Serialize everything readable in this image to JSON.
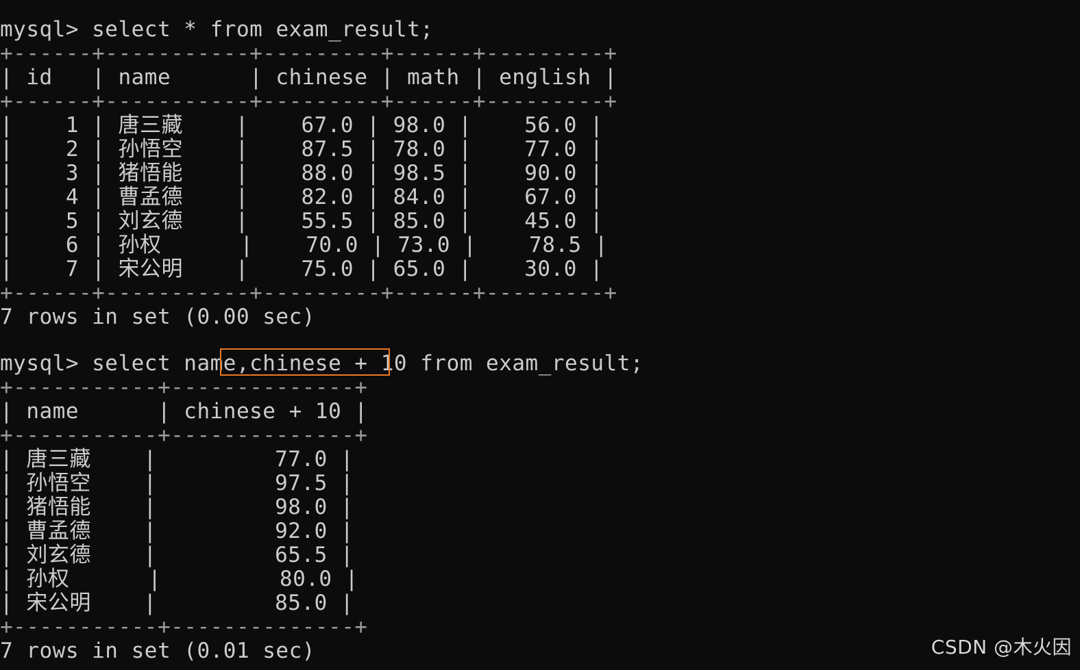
{
  "prompt": "mysql>",
  "query1": {
    "command_text": " select * from exam_result;",
    "border": "+------+-----------+---------+------+---------+",
    "header": "| id   | name      | chinese | math | english |",
    "rows": [
      "|    1 | 唐三藏    |    67.0 | 98.0 |    56.0 |",
      "|    2 | 孙悟空    |    87.5 | 78.0 |    77.0 |",
      "|    3 | 猪悟能    |    88.0 | 98.5 |    90.0 |",
      "|    4 | 曹孟德    |    82.0 | 84.0 |    67.0 |",
      "|    5 | 刘玄德    |    55.5 | 85.0 |    45.0 |",
      "|    6 | 孙权      |    70.0 | 73.0 |    78.5 |",
      "|    7 | 宋公明    |    75.0 | 65.0 |    30.0 |"
    ],
    "summary": "7 rows in set (0.00 sec)"
  },
  "query2": {
    "command_text": " select name,chinese + 10 from exam_result;",
    "border": "+-----------+--------------+",
    "header": "| name      | chinese + 10 |",
    "rows": [
      "| 唐三藏    |         77.0 |",
      "| 孙悟空    |         97.5 |",
      "| 猪悟能    |         98.0 |",
      "| 曹孟德    |         92.0 |",
      "| 刘玄德    |         65.5 |",
      "| 孙权      |         80.0 |",
      "| 宋公明    |         85.0 |"
    ],
    "summary": "7 rows in set (0.01 sec)"
  },
  "highlight": {
    "color": "#e97824"
  },
  "watermark": "CSDN @木火因",
  "colors": {
    "background": "#0c0c0c",
    "text": "#cccccc"
  }
}
